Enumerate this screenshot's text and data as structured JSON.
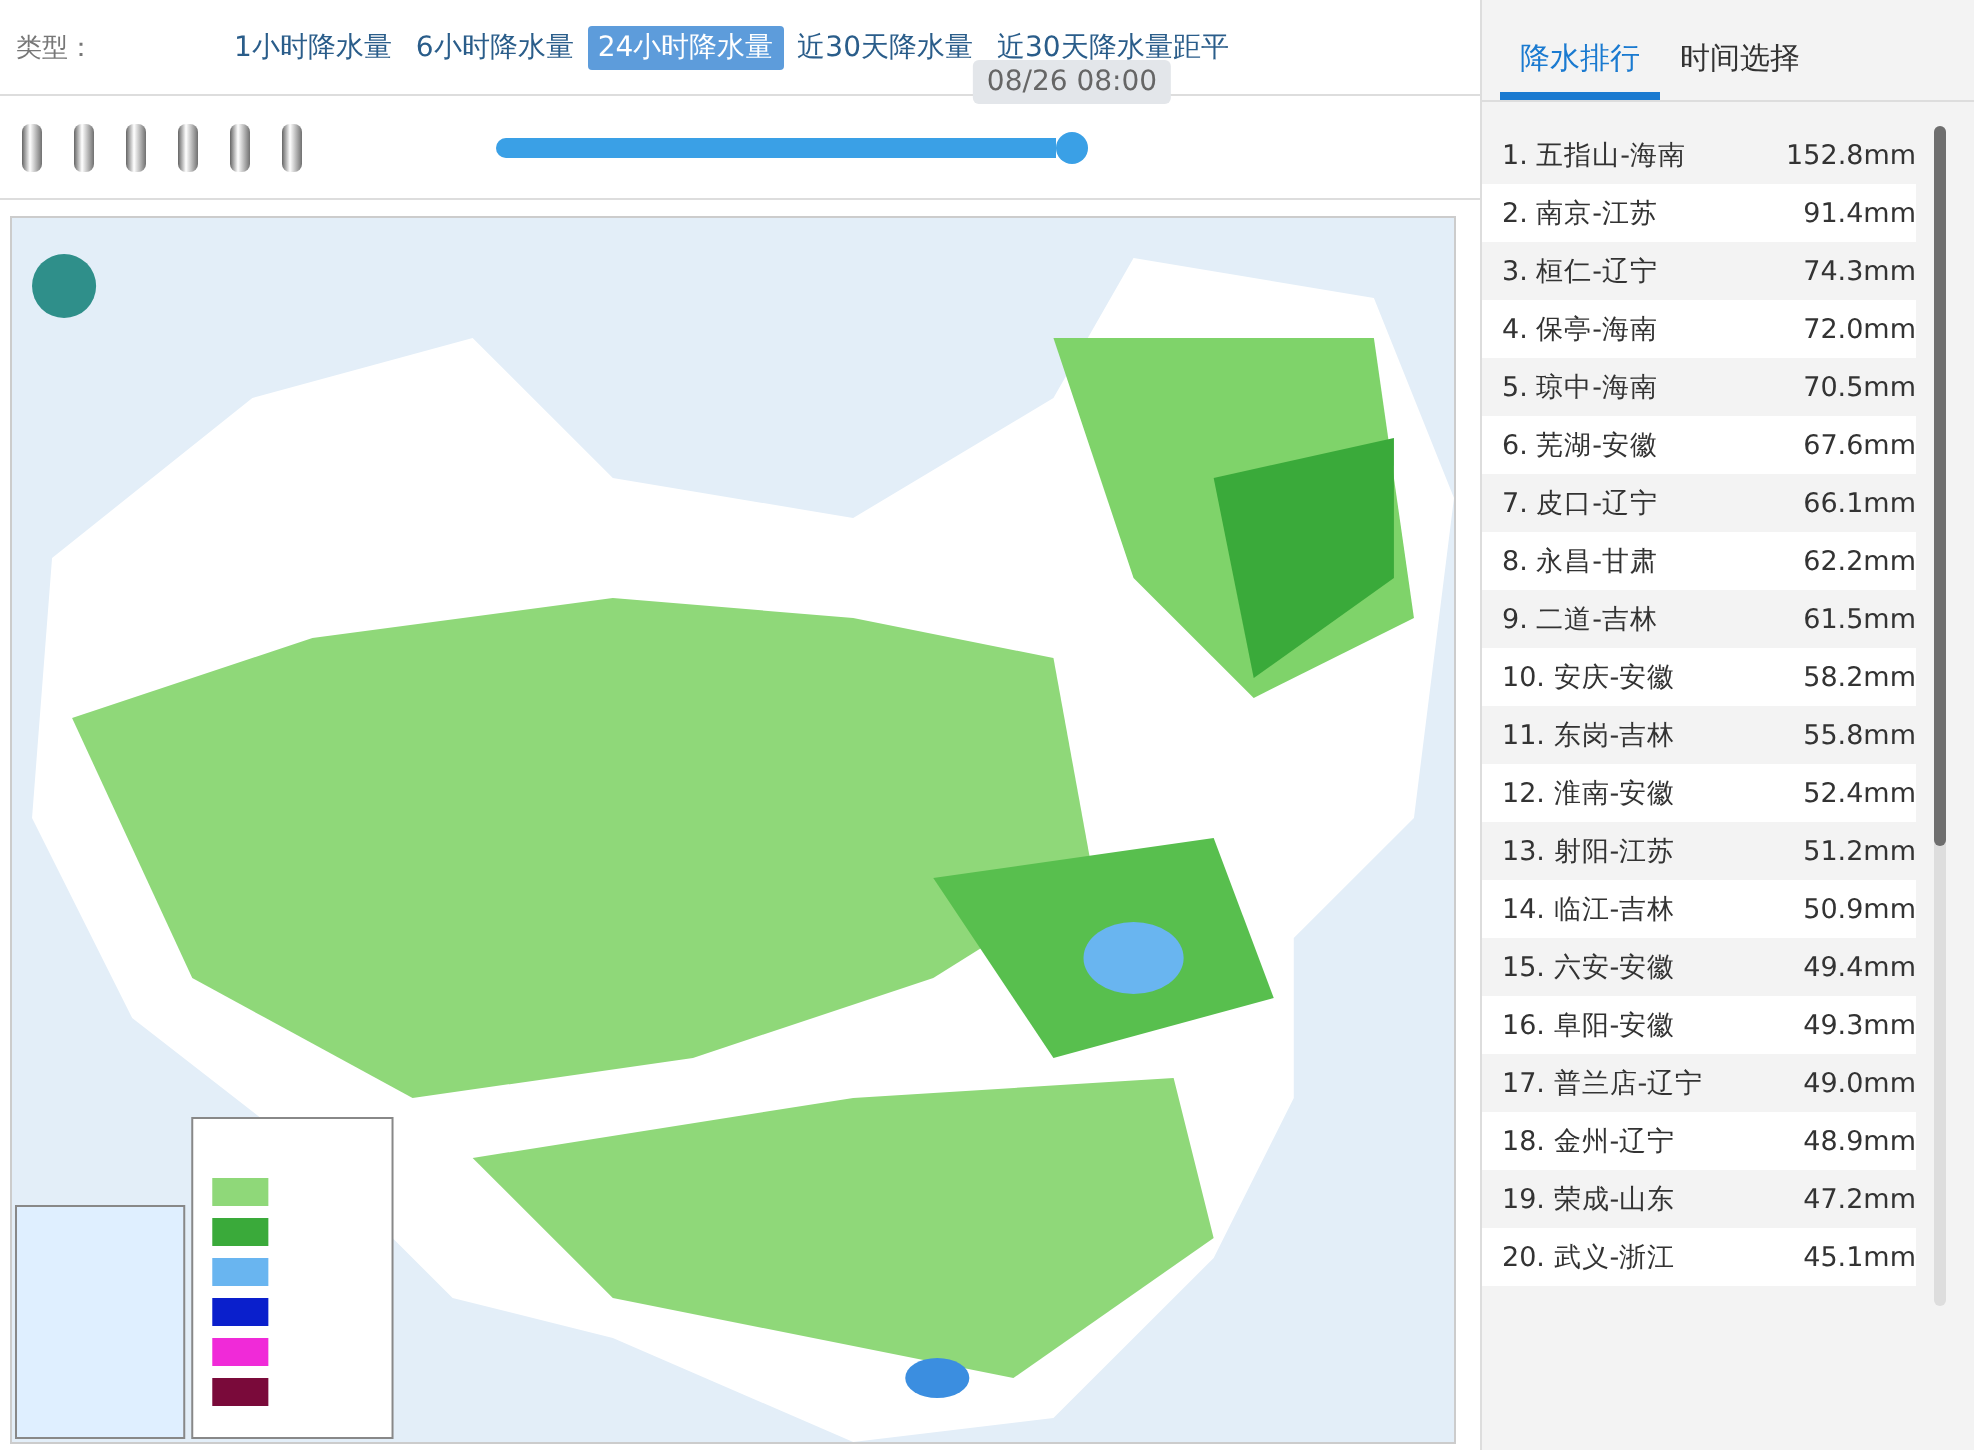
{
  "type_bar": {
    "label": "类型：",
    "options": [
      {
        "label": "1小时降水量",
        "selected": false
      },
      {
        "label": "6小时降水量",
        "selected": false
      },
      {
        "label": "24小时降水量",
        "selected": true
      },
      {
        "label": "近30天降水量",
        "selected": false
      },
      {
        "label": "近30天降水量距平",
        "selected": false
      }
    ]
  },
  "timeline": {
    "level": 1,
    "tooltip": "08/26 08:00"
  },
  "side_panel": {
    "tabs": [
      {
        "label": "降水排行",
        "selected": true
      },
      {
        "label": "时间选择",
        "selected": false
      }
    ],
    "ranking": [
      {
        "name": "1. 五指山-海南",
        "value": "152.8mm"
      },
      {
        "name": "2. 南京-江苏",
        "value": "91.4mm"
      },
      {
        "name": "3. 桓仁-辽宁",
        "value": "74.3mm"
      },
      {
        "name": "4. 保亭-海南",
        "value": "72.0mm"
      },
      {
        "name": "5. 琼中-海南",
        "value": "70.5mm"
      },
      {
        "name": "6. 芜湖-安徽",
        "value": "67.6mm"
      },
      {
        "name": "7. 皮口-辽宁",
        "value": "66.1mm"
      },
      {
        "name": "8. 永昌-甘肃",
        "value": "62.2mm"
      },
      {
        "name": "9. 二道-吉林",
        "value": "61.5mm"
      },
      {
        "name": "10. 安庆-安徽",
        "value": "58.2mm"
      },
      {
        "name": "11. 东岗-吉林",
        "value": "55.8mm"
      },
      {
        "name": "12. 淮南-安徽",
        "value": "52.4mm"
      },
      {
        "name": "13. 射阳-江苏",
        "value": "51.2mm"
      },
      {
        "name": "14. 临江-吉林",
        "value": "50.9mm"
      },
      {
        "name": "15. 六安-安徽",
        "value": "49.4mm"
      },
      {
        "name": "16. 阜阳-安徽",
        "value": "49.3mm"
      },
      {
        "name": "17. 普兰店-辽宁",
        "value": "49.0mm"
      },
      {
        "name": "18. 金州-辽宁",
        "value": "48.9mm"
      },
      {
        "name": "19. 荣成-山东",
        "value": "47.2mm"
      },
      {
        "name": "20. 武义-浙江",
        "value": "45.1mm"
      }
    ]
  }
}
